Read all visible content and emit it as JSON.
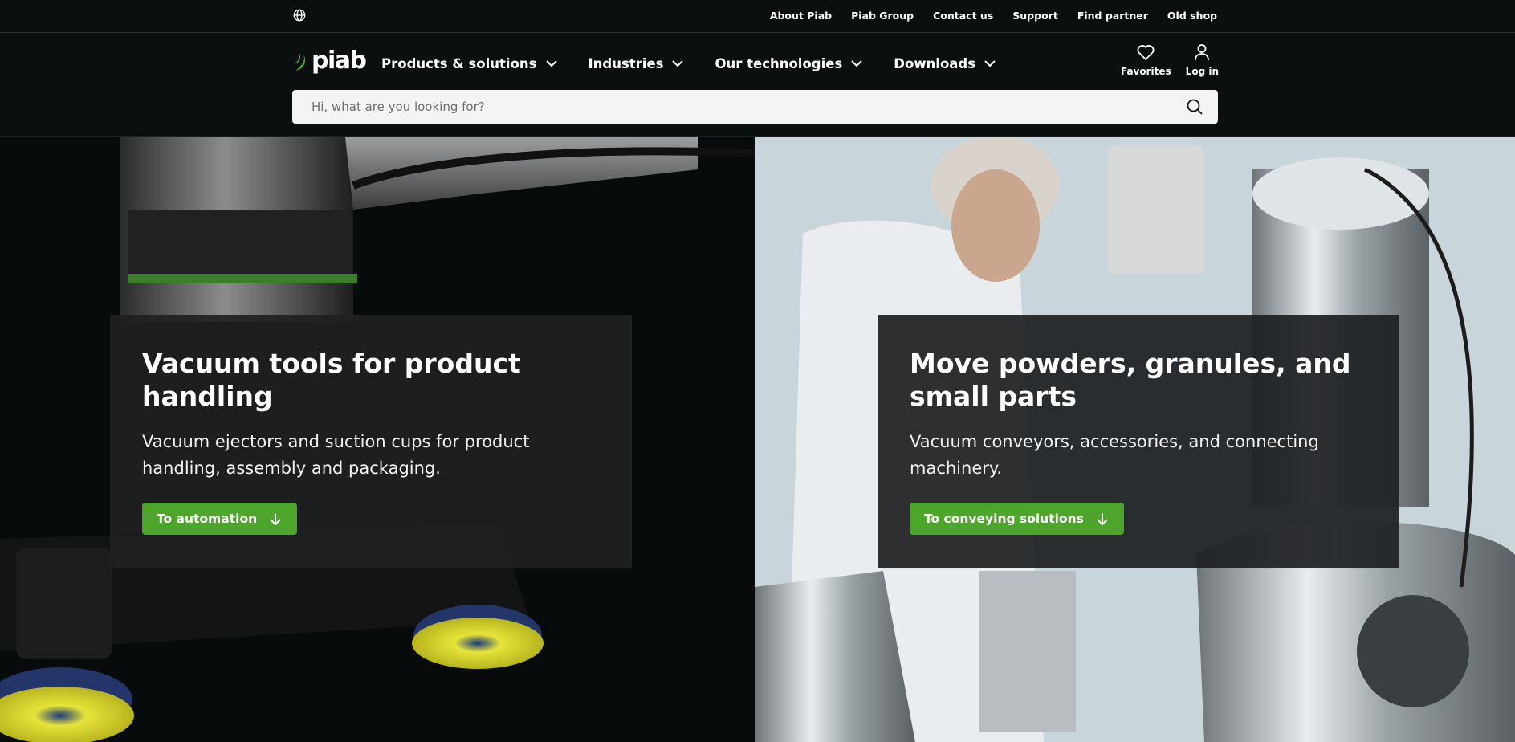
{
  "top_links": [
    "About Piab",
    "Piab Group",
    "Contact us",
    "Support",
    "Find partner",
    "Old shop"
  ],
  "brand": {
    "name": "piab",
    "accent": "#4ea52b"
  },
  "nav": [
    {
      "label": "Products & solutions"
    },
    {
      "label": "Industries"
    },
    {
      "label": "Our technologies"
    },
    {
      "label": "Downloads"
    }
  ],
  "user_actions": {
    "favorites": "Favorites",
    "login": "Log in"
  },
  "search": {
    "placeholder": "Hi, what are you looking for?",
    "value": ""
  },
  "hero": {
    "left": {
      "title": "Vacuum tools for product handling",
      "text": "Vacuum ejectors and suction cups for product handling, assembly and packaging.",
      "cta": "To automation"
    },
    "right": {
      "title": "Move powders, granules, and small parts",
      "text": "Vacuum conveyors, accessories, and connecting machinery.",
      "cta": "To conveying solutions"
    }
  },
  "icons": [
    "globe-icon",
    "piab-logo-mark",
    "chevron-down-icon",
    "heart-icon",
    "user-icon",
    "search-icon",
    "arrow-down-icon"
  ]
}
